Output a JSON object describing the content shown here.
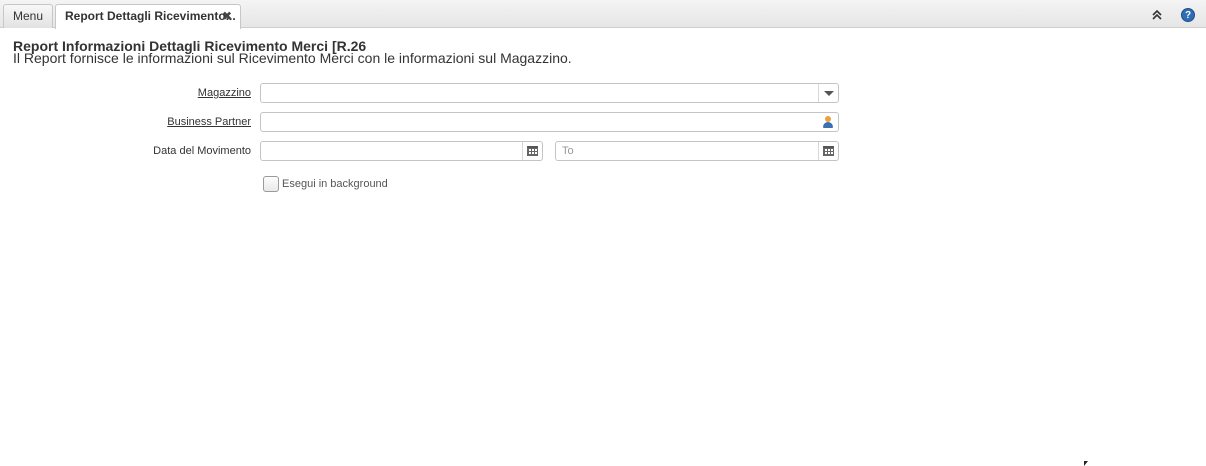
{
  "tabs": {
    "menu_label": "Menu",
    "active_label": "Report Dettagli Ricevimento...",
    "close_symbol": "✖"
  },
  "toolbar": {
    "collapse_icon": "chevron-double-up-icon",
    "help_icon": "help-icon",
    "help_symbol": "?"
  },
  "report": {
    "title": "Report Informazioni Dettagli Ricevimento Merci [R.26",
    "description": "Il Report fornisce le informazioni sul Ricevimento Merci con le informazioni sul Magazzino."
  },
  "form": {
    "warehouse_label": "Magazzino",
    "warehouse_value": "",
    "business_partner_label": "Business Partner",
    "business_partner_value": "",
    "movement_date_label": "Data del Movimento",
    "movement_date_from": "",
    "movement_date_to_placeholder": "To",
    "background_label": "Esegui in background",
    "background_checked": false
  },
  "colors": {
    "help_blue": "#2f6db5",
    "partner_icon_orange": "#e8a13b"
  }
}
